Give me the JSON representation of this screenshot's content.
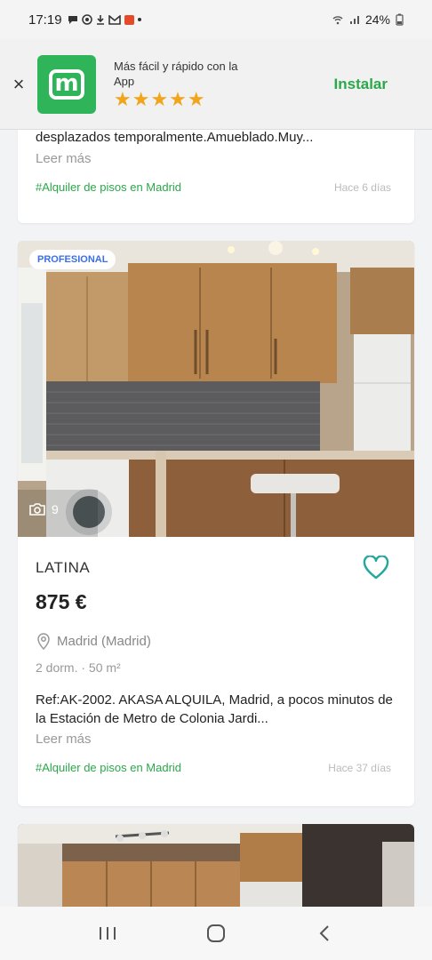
{
  "status_bar": {
    "time": "17:19",
    "battery": "24%"
  },
  "app_banner": {
    "close": "×",
    "logo_letter": "m",
    "title": "Más fácil y rápido con la App",
    "stars": "★★★★★",
    "install": "Instalar"
  },
  "listings": [
    {
      "description": "desplazados temporalmente.Amueblado.Muy...",
      "read_more": "Leer más",
      "category_link": "#Alquiler de pisos en Madrid",
      "time_ago": "Hace 6 días"
    },
    {
      "badge": "PROFESIONAL",
      "photo_count": "9",
      "district": "LATINA",
      "price": "875 €",
      "location": "Madrid (Madrid)",
      "features": "2 dorm. · 50 m²",
      "description": "Ref:AK-2002. AKASA ALQUILA, Madrid, a pocos minutos de la Estación de Metro de Colonia Jardi...",
      "read_more": "Leer más",
      "category_link": "#Alquiler de pisos en Madrid",
      "time_ago": "Hace 37 días"
    }
  ],
  "colors": {
    "brand_green": "#2fb45a",
    "link_green": "#2aa84a",
    "badge_blue": "#3a6fe8",
    "star_orange": "#f0a51a"
  }
}
